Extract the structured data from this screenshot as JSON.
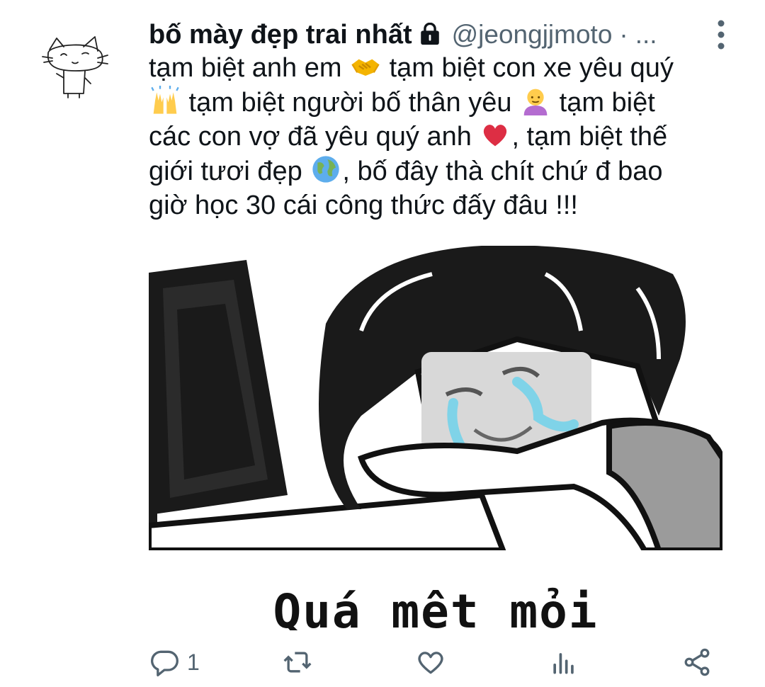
{
  "tweet": {
    "display_name": "bố mày đẹp trai nhất",
    "handle": "@jeongjjmoto",
    "separator": "·",
    "truncation": "...",
    "text_lines": [
      {
        "before": "tạm biệt anh em ",
        "emoji": "handshake",
        "after": " tạm biệt con xe yêu quý"
      },
      {
        "before": "",
        "emoji": "raising-hands",
        "after": " tạm biệt người bố thân yêu ",
        "emoji2": "man-bald",
        "after2": " tạm biệt"
      },
      {
        "before": "các con vợ đã yêu quý anh ",
        "emoji": "red-heart",
        "after": ", tạm biệt thế"
      },
      {
        "before": "giới tươi đẹp ",
        "emoji": "globe",
        "after": ", bố đây thà chít chứ đ bao"
      },
      {
        "before": "giờ học 30 cái công thức đấy đâu !!!",
        "emoji": "",
        "after": ""
      }
    ],
    "media_caption": "Quá mệt mỏi"
  },
  "actions": {
    "reply_count": "1",
    "icons": [
      "reply-icon",
      "retweet-icon",
      "like-icon",
      "analytics-icon",
      "share-icon"
    ]
  },
  "colors": {
    "text": "#0f1419",
    "secondary": "#536471",
    "icon": "#536471",
    "tear": "#7fd3e8"
  }
}
